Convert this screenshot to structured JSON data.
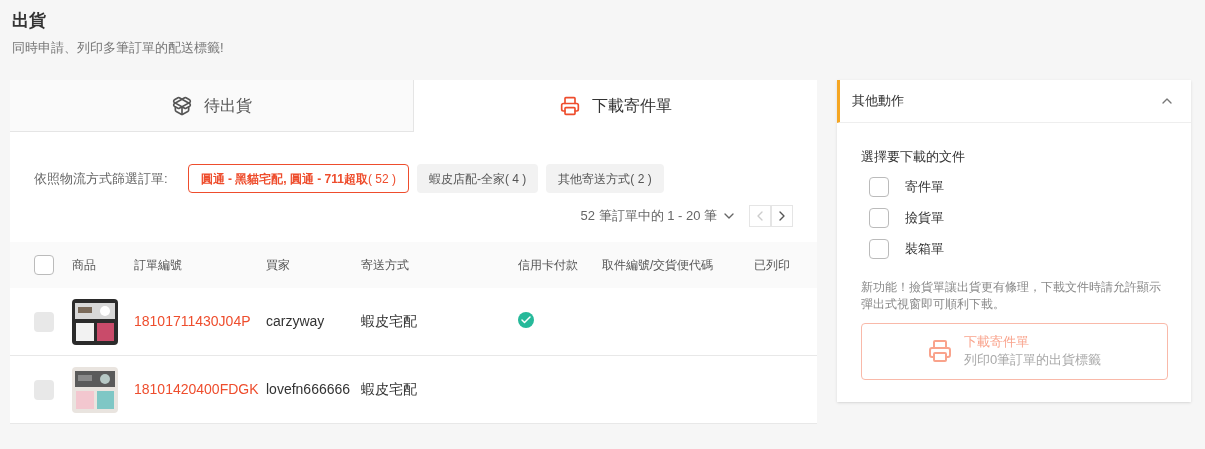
{
  "page": {
    "title": "出貨",
    "subtitle": "同時申請、列印多筆訂單的配送標籤!"
  },
  "tabs": [
    {
      "label": "待出貨",
      "kind": "package",
      "selected": false
    },
    {
      "label": "下載寄件單",
      "kind": "printer",
      "selected": true
    }
  ],
  "filter": {
    "label": "依照物流方式篩選訂單:",
    "options": [
      {
        "label": "圓通 - 黑貓宅配, 圓通 - 711超取",
        "count": "( 52 )",
        "selected": true
      },
      {
        "label": "蝦皮店配-全家",
        "count": "( 4 )",
        "selected": false
      },
      {
        "label": "其他寄送方式",
        "count": "( 2 )",
        "selected": false
      }
    ]
  },
  "pagination": {
    "summary": "52 筆訂單中的 1 - 20 筆",
    "prev_disabled": true,
    "next_disabled": false
  },
  "table": {
    "select_all": {
      "checked": false,
      "disabled": false
    },
    "columns": [
      "商品",
      "訂單編號",
      "買家",
      "寄送方式",
      "信用卡付款",
      "取件編號/交貨便代碼",
      "已列印"
    ],
    "rows": [
      {
        "checked": false,
        "disabled": true,
        "order_no": "18101711430J04P",
        "buyer": "carzyway",
        "shipping": "蝦皮宅配",
        "card_paid": true
      },
      {
        "checked": false,
        "disabled": true,
        "order_no": "18101420400FDGK",
        "buyer": "lovefn666666",
        "shipping": "蝦皮宅配",
        "card_paid": false
      }
    ]
  },
  "side_panel": {
    "title": "其他動作",
    "expanded": true,
    "documents_label": "選擇要下載的文件",
    "documents": [
      {
        "label": "寄件單",
        "checked": false
      },
      {
        "label": "撿貨單",
        "checked": false
      },
      {
        "label": "裝箱單",
        "checked": false
      }
    ],
    "note": "新功能！撿貨單讓出貨更有條理，下載文件時請允許顯示彈出式視窗即可順利下載。",
    "download": {
      "label": "下載寄件單",
      "sub": "列印0筆訂單的出貨標籤",
      "disabled": true
    }
  }
}
